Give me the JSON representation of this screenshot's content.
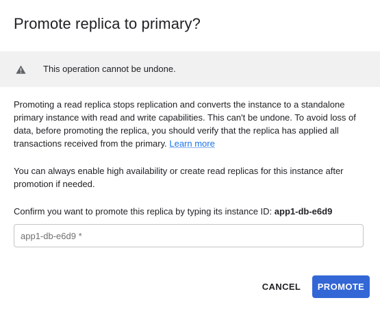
{
  "dialog": {
    "title": "Promote replica to primary?"
  },
  "warning": {
    "icon": "warning-icon",
    "text": "This operation cannot be undone."
  },
  "body": {
    "paragraph1": "Promoting a read replica stops replication and converts the instance to a standalone primary instance with read and write capabilities. This can't be undone. To avoid loss of data, before promoting the replica, you should verify that the replica has applied all transactions received from the primary.",
    "learn_more": "Learn more",
    "paragraph2": "You can always enable high availability or create read replicas for this instance after promotion if needed."
  },
  "confirm": {
    "prompt": "Confirm you want to promote this replica by typing its instance ID:",
    "instance_id": "app1-db-e6d9",
    "input_value": "",
    "input_placeholder": "app1-db-e6d9 *"
  },
  "actions": {
    "cancel_label": "CANCEL",
    "promote_label": "PROMOTE"
  },
  "colors": {
    "primary": "#3367d6",
    "link": "#1a73e8",
    "banner_bg": "#f1f1f1"
  }
}
